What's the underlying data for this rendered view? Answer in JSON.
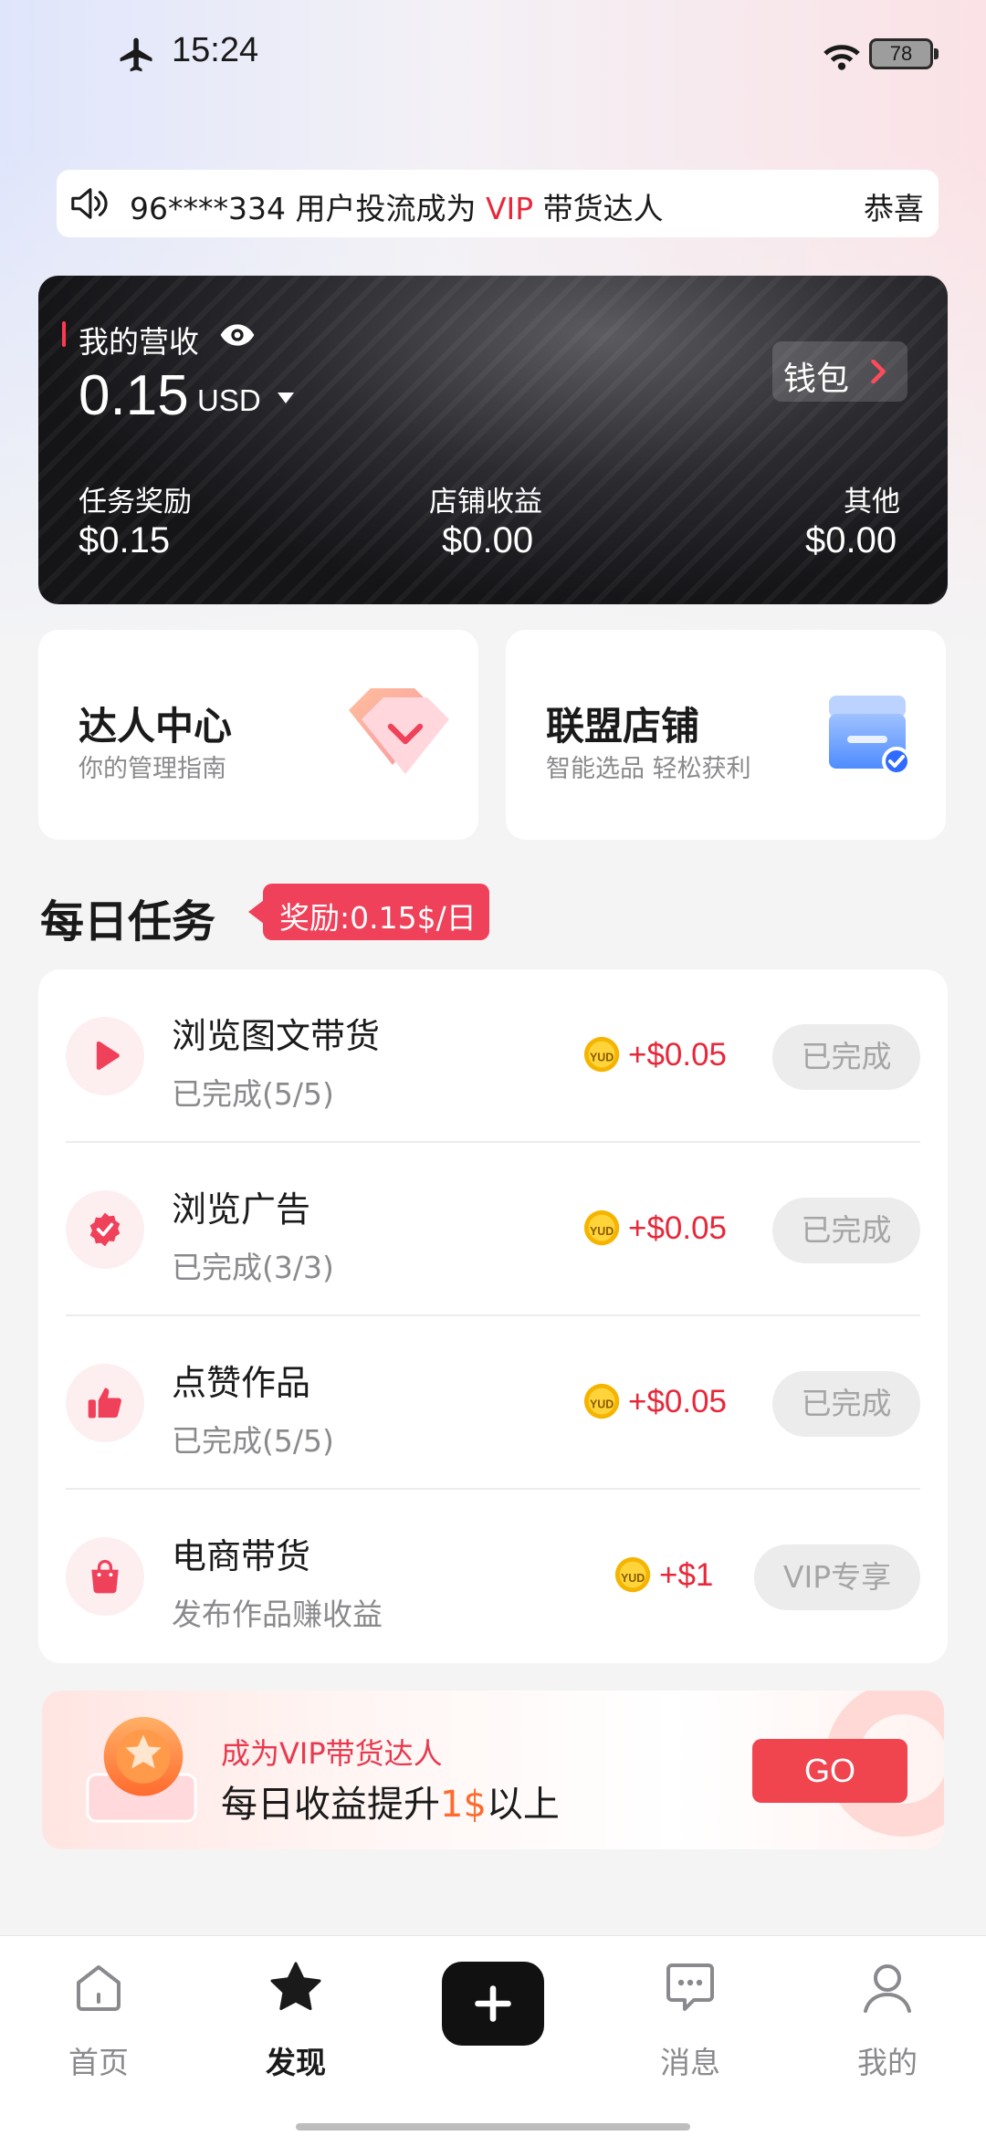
{
  "status_bar": {
    "time": "15:24",
    "battery": "78"
  },
  "notice": {
    "message_pre": "96****334 用户投流成为 ",
    "message_vip": "VIP",
    "message_post": " 带货达人",
    "right_text": "恭喜"
  },
  "earnings": {
    "title": "我的营收",
    "amount": "0.15",
    "currency": "USD",
    "wallet_label": "钱包",
    "columns": [
      {
        "label": "任务奖励",
        "value": "$0.15"
      },
      {
        "label": "店铺收益",
        "value": "$0.00"
      },
      {
        "label": "其他",
        "value": "$0.00"
      }
    ]
  },
  "quick_cards": [
    {
      "title": "达人中心",
      "subtitle": "你的管理指南"
    },
    {
      "title": "联盟店铺",
      "subtitle": "智能选品 轻松获利"
    }
  ],
  "daily_tasks": {
    "title": "每日任务",
    "reward_badge": "奖励:0.15$/日",
    "items": [
      {
        "name": "浏览图文带货",
        "progress": "已完成(5/5)",
        "reward": "+$0.05",
        "button": "已完成",
        "icon": "play-icon"
      },
      {
        "name": "浏览广告",
        "progress": "已完成(3/3)",
        "reward": "+$0.05",
        "button": "已完成",
        "icon": "verified-badge-icon"
      },
      {
        "name": "点赞作品",
        "progress": "已完成(5/5)",
        "reward": "+$0.05",
        "button": "已完成",
        "icon": "thumbs-up-icon"
      },
      {
        "name": "电商带货",
        "progress": "发布作品赚收益",
        "reward": "+$1",
        "button": "VIP专享",
        "icon": "shopping-bag-icon"
      }
    ]
  },
  "vip_banner": {
    "line1": "成为VIP带货达人",
    "line2_pre": "每日收益提升",
    "line2_highlight": "1$",
    "line2_post": "以上",
    "button": "GO"
  },
  "bottom_nav": {
    "items": [
      {
        "label": "首页",
        "icon": "home-icon"
      },
      {
        "label": "发现",
        "icon": "star-icon",
        "active": true
      },
      {
        "label": "消息",
        "icon": "message-icon"
      },
      {
        "label": "我的",
        "icon": "profile-icon"
      }
    ]
  },
  "colors": {
    "accent": "#f0415a",
    "reward_red": "#e8283a",
    "muted": "#8a8a8e"
  }
}
